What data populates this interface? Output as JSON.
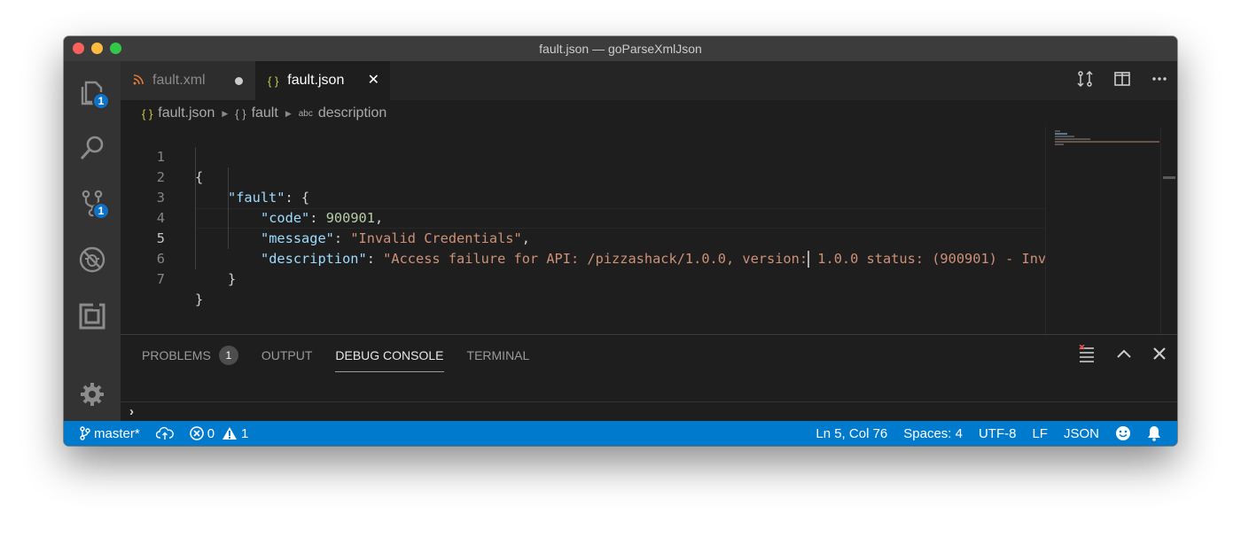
{
  "window": {
    "title": "fault.json — goParseXmlJson"
  },
  "activity_bar": {
    "explorer_badge": "1",
    "scm_badge": "1"
  },
  "tabs": [
    {
      "label": "fault.xml",
      "icon": "rss-icon",
      "dirty": true,
      "active": false
    },
    {
      "label": "fault.json",
      "icon": "braces-icon",
      "icon_text": "{ }",
      "active": true
    }
  ],
  "breadcrumbs": {
    "file": "fault.json",
    "object": "fault",
    "property": "description",
    "file_icon": "{ }",
    "object_icon": "{ }",
    "property_icon": "abc"
  },
  "editor": {
    "line_numbers": [
      "1",
      "2",
      "3",
      "4",
      "5",
      "6",
      "7"
    ],
    "current_line": 5,
    "lines": {
      "l1": "{",
      "l2_key": "\"fault\"",
      "l2_rest": ": {",
      "l3_key": "\"code\"",
      "l3_colon": ": ",
      "l3_value": "900901",
      "l3_comma": ",",
      "l4_key": "\"message\"",
      "l4_colon": ": ",
      "l4_value": "\"Invalid Credentials\"",
      "l4_comma": ",",
      "l5_key": "\"description\"",
      "l5_colon": ": ",
      "l5_value_a": "\"Access failure for API: /pizzashack/1.0.0, version:",
      "l5_value_b": " 1.0.0 status: (900901) - Inv",
      "l6": "}",
      "l7": "}"
    }
  },
  "panel": {
    "tabs": [
      {
        "label": "PROBLEMS",
        "count": "1"
      },
      {
        "label": "OUTPUT"
      },
      {
        "label": "DEBUG CONSOLE",
        "active": true
      },
      {
        "label": "TERMINAL"
      }
    ],
    "prompt": "›"
  },
  "status_bar": {
    "branch": "master*",
    "errors": "0",
    "warnings": "1",
    "position": "Ln 5, Col 76",
    "spaces": "Spaces: 4",
    "encoding": "UTF-8",
    "eol": "LF",
    "language": "JSON"
  },
  "colors": {
    "accent": "#007acc",
    "badge": "#0e73c8",
    "string": "#ce9178",
    "key": "#9cdcfe",
    "number": "#b5cea8"
  }
}
